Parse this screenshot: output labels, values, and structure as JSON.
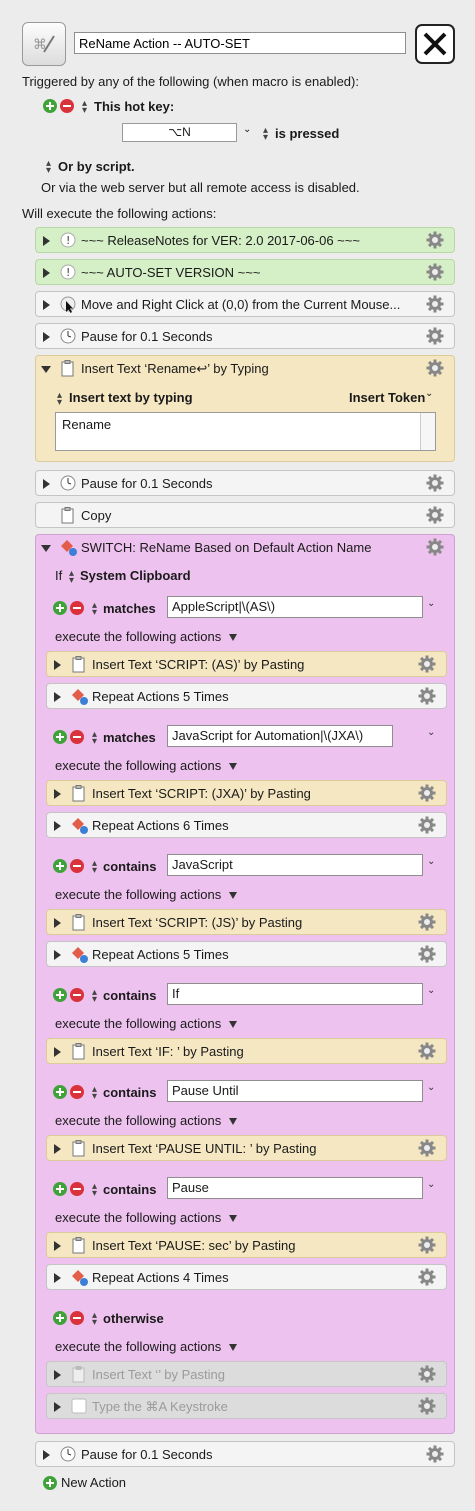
{
  "macro": {
    "name": "ReName Action -- AUTO-SET"
  },
  "triggers": {
    "intro": "Triggered by any of the following (when macro is enabled):",
    "hotkey_label": "This hot key:",
    "hotkey_value": "⌥N",
    "hotkey_state": "is pressed",
    "or_script": "Or by script.",
    "web_server": "Or via the web server but all remote access is disabled."
  },
  "actions_intro": "Will execute the following actions:",
  "actions": [
    {
      "label": "~~~ ReleaseNotes for  VER: 2.0    2017-06-06 ~~~"
    },
    {
      "label": "~~~ AUTO-SET VERSION ~~~"
    },
    {
      "label": "Move and Right Click at (0,0) from the Current Mouse..."
    },
    {
      "label": "Pause for 0.1 Seconds"
    },
    {
      "label": "Insert Text ‘Rename↩’ by Typing"
    },
    {
      "label": "Pause for 0.1 Seconds"
    },
    {
      "label": "Copy"
    },
    {
      "label": "SWITCH: ReName Based on Default Action Name"
    },
    {
      "label": "Pause for 0.1 Seconds"
    }
  ],
  "insert_text_panel": {
    "mode": "Insert text by typing",
    "insert_token": "Insert Token",
    "text": "Rename"
  },
  "switch": {
    "if_prefix": "If",
    "source": "System Clipboard",
    "execute": "execute the following actions",
    "cases": [
      {
        "op": "matches",
        "value": "AppleScript|\\(AS\\)",
        "actions": [
          "Insert Text ‘SCRIPT:   (AS)’ by Pasting",
          "Repeat Actions 5 Times"
        ]
      },
      {
        "op": "matches",
        "value": "JavaScript for Automation|\\(JXA\\)",
        "actions": [
          "Insert Text ‘SCRIPT:   (JXA)’ by Pasting",
          "Repeat Actions 6 Times"
        ]
      },
      {
        "op": "contains",
        "value": "JavaScript",
        "actions": [
          "Insert Text ‘SCRIPT:   (JS)’ by Pasting",
          "Repeat Actions 5 Times"
        ]
      },
      {
        "op": "contains",
        "value": "If",
        "actions": [
          "Insert Text ‘IF:  ’ by Pasting"
        ]
      },
      {
        "op": "contains",
        "value": "Pause Until",
        "actions": [
          "Insert Text ‘PAUSE UNTIL:  ’ by Pasting"
        ]
      },
      {
        "op": "contains",
        "value": "Pause",
        "actions": [
          "Insert Text ‘PAUSE:   sec’ by Pasting",
          "Repeat Actions 4 Times"
        ]
      }
    ],
    "otherwise": {
      "op": "otherwise",
      "actions": [
        "Insert Text ‘’ by Pasting",
        "Type the ⌘A Keystroke"
      ]
    }
  },
  "new_action": "New Action",
  "colors": {
    "green_row": "#d5efc6",
    "yellow_row": "#f5e7c2",
    "pink_row": "#eec2ef",
    "plus": "#3fa33a",
    "minus": "#d9323a"
  }
}
